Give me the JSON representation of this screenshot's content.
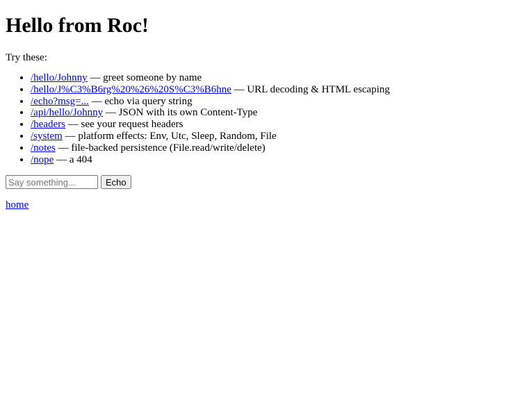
{
  "heading": "Hello from Roc!",
  "intro": "Try these:",
  "routes": [
    {
      "link": "/hello/Johnny",
      "desc": " — greet someone by name"
    },
    {
      "link": "/hello/J%C3%B6rg%20%26%20S%C3%B6hne",
      "desc": " — URL decoding & HTML escaping"
    },
    {
      "link": "/echo?msg=...",
      "desc": " — echo via query string"
    },
    {
      "link": "/api/hello/Johnny",
      "desc": " — JSON with its own Content-Type"
    },
    {
      "link": "/headers",
      "desc": " — see your request headers"
    },
    {
      "link": "/system",
      "desc": " — platform effects: Env, Utc, Sleep, Random, File"
    },
    {
      "link": "/notes",
      "desc": " — file-backed persistence (File.read/write/delete)"
    },
    {
      "link": "/nope",
      "desc": " — a 404"
    }
  ],
  "form": {
    "placeholder": "Say something...",
    "value": "",
    "button_label": "Echo"
  },
  "footer": {
    "home_label": "home"
  },
  "colors": {
    "link": "#0000ee"
  }
}
